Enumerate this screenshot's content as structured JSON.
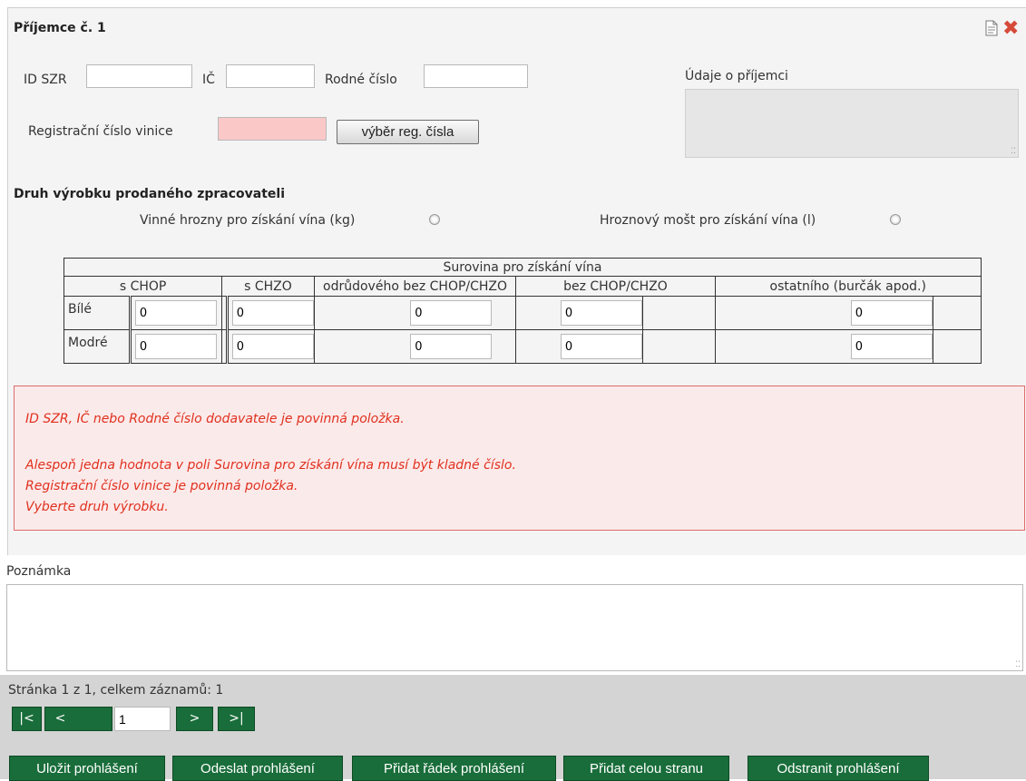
{
  "panel": {
    "title": "Příjemce č. 1",
    "icons": [
      "document-icon",
      "close-icon"
    ]
  },
  "ids": {
    "id_szr_label": "ID SZR",
    "id_szr_value": "",
    "ic_label": "IČ",
    "ic_value": "",
    "rc_label": "Rodné číslo",
    "rc_value": "",
    "reg_label": "Registrační číslo vinice",
    "reg_value": "",
    "reg_button": "výběr reg. čísla"
  },
  "info": {
    "label": "Údaje o příjemci"
  },
  "product": {
    "title": "Druh výrobku prodaného zpracovateli",
    "option1": "Vinné hrozny pro získání vína (kg)",
    "option2": "Hroznový mošt pro získání vína (l)"
  },
  "table": {
    "caption": "Surovina pro získání vína",
    "columns": [
      "s CHOP",
      "s CHZO",
      "odrůdového bez CHOP/CHZO",
      "bez CHOP/CHZO",
      "ostatního (burčák apod.)"
    ],
    "rows": [
      {
        "label": "Bílé",
        "values": [
          "0",
          "0",
          "0",
          "0",
          "0"
        ]
      },
      {
        "label": "Modré",
        "values": [
          "0",
          "0",
          "0",
          "0",
          "0"
        ]
      }
    ]
  },
  "errors": [
    "ID SZR, IČ nebo Rodné číslo dodavatele je povinná položka.",
    "Alespoň jedna hodnota v poli Surovina pro získání vína musí být kladné číslo.",
    "Registrační číslo vinice je povinná položka.",
    "Vyberte druh výrobku."
  ],
  "note": {
    "label": "Poznámka",
    "value": ""
  },
  "pager": {
    "text": "Stránka 1 z 1, celkem záznamů: 1",
    "first": "|<",
    "prev": "<",
    "page": "1",
    "next": ">",
    "last": ">|"
  },
  "actions": {
    "save": "Uložit prohlášení",
    "send": "Odeslat prohlášení",
    "add_row": "Přidat řádek prohlášení",
    "add_page": "Přidat celou stranu",
    "delete": "Odstranit prohlášení"
  },
  "colors": {
    "button_green": "#196d3a",
    "error_red": "#e0301e",
    "required_pink": "#fbc8c8"
  }
}
